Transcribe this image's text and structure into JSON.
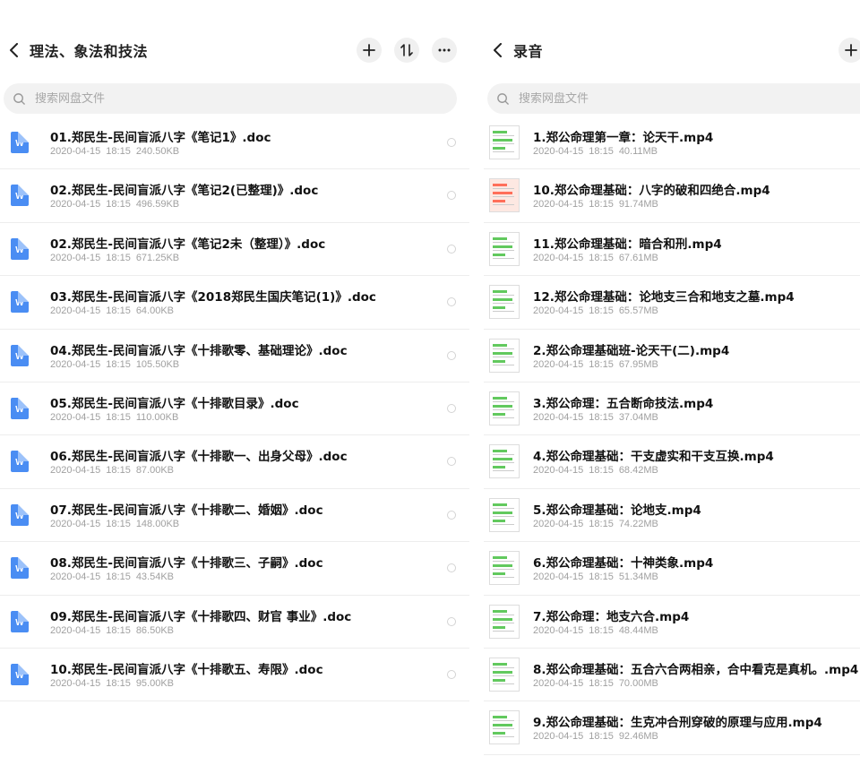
{
  "left": {
    "title": "理法、象法和技法",
    "search_placeholder": "搜索网盘文件",
    "icon_letter": "W",
    "files": [
      {
        "name": "01.郑民生-民间盲派八字《笔记1》.doc",
        "date": "2020-04-15",
        "time": "18:15",
        "size": "240.50KB"
      },
      {
        "name": "02.郑民生-民间盲派八字《笔记2(已整理)》.doc",
        "date": "2020-04-15",
        "time": "18:15",
        "size": "496.59KB"
      },
      {
        "name": "02.郑民生-民间盲派八字《笔记2未（整理）》.doc",
        "date": "2020-04-15",
        "time": "18:15",
        "size": "671.25KB"
      },
      {
        "name": "03.郑民生-民间盲派八字《2018郑民生国庆笔记(1)》.doc",
        "date": "2020-04-15",
        "time": "18:15",
        "size": "64.00KB"
      },
      {
        "name": "04.郑民生-民间盲派八字《十排歌零、基础理论》.doc",
        "date": "2020-04-15",
        "time": "18:15",
        "size": "105.50KB"
      },
      {
        "name": "05.郑民生-民间盲派八字《十排歌目录》.doc",
        "date": "2020-04-15",
        "time": "18:15",
        "size": "110.00KB"
      },
      {
        "name": "06.郑民生-民间盲派八字《十排歌一、出身父母》.doc",
        "date": "2020-04-15",
        "time": "18:15",
        "size": "87.00KB"
      },
      {
        "name": "07.郑民生-民间盲派八字《十排歌二、婚姻》.doc",
        "date": "2020-04-15",
        "time": "18:15",
        "size": "148.00KB"
      },
      {
        "name": "08.郑民生-民间盲派八字《十排歌三、子嗣》.doc",
        "date": "2020-04-15",
        "time": "18:15",
        "size": "43.54KB"
      },
      {
        "name": "09.郑民生-民间盲派八字《十排歌四、财官 事业》.doc",
        "date": "2020-04-15",
        "time": "18:15",
        "size": "86.50KB"
      },
      {
        "name": "10.郑民生-民间盲派八字《十排歌五、寿限》.doc",
        "date": "2020-04-15",
        "time": "18:15",
        "size": "95.00KB"
      }
    ]
  },
  "right": {
    "title": "录音",
    "search_placeholder": "搜索网盘文件",
    "files": [
      {
        "name": "1.郑公命理第一章：论天干.mp4",
        "date": "2020-04-15",
        "time": "18:15",
        "size": "40.11MB"
      },
      {
        "name": "10.郑公命理基础：八字的破和四绝合.mp4",
        "date": "2020-04-15",
        "time": "18:15",
        "size": "91.74MB"
      },
      {
        "name": "11.郑公命理基础：暗合和刑.mp4",
        "date": "2020-04-15",
        "time": "18:15",
        "size": "67.61MB"
      },
      {
        "name": "12.郑公命理基础：论地支三合和地支之墓.mp4",
        "date": "2020-04-15",
        "time": "18:15",
        "size": "65.57MB"
      },
      {
        "name": "2.郑公命理基础班-论天干(二).mp4",
        "date": "2020-04-15",
        "time": "18:15",
        "size": "67.95MB"
      },
      {
        "name": "3.郑公命理：五合断命技法.mp4",
        "date": "2020-04-15",
        "time": "18:15",
        "size": "37.04MB"
      },
      {
        "name": "4.郑公命理基础：干支虚实和干支互换.mp4",
        "date": "2020-04-15",
        "time": "18:15",
        "size": "68.42MB"
      },
      {
        "name": "5.郑公命理基础：论地支.mp4",
        "date": "2020-04-15",
        "time": "18:15",
        "size": "74.22MB"
      },
      {
        "name": "6.郑公命理基础：十神类象.mp4",
        "date": "2020-04-15",
        "time": "18:15",
        "size": "51.34MB"
      },
      {
        "name": "7.郑公命理：地支六合.mp4",
        "date": "2020-04-15",
        "time": "18:15",
        "size": "48.44MB"
      },
      {
        "name": "8.郑公命理基础：五合六合两相亲，合中看克是真机。.mp4",
        "date": "2020-04-15",
        "time": "18:15",
        "size": "70.00MB"
      },
      {
        "name": "9.郑公命理基础：生克冲合刑穿破的原理与应用.mp4",
        "date": "2020-04-15",
        "time": "18:15",
        "size": "92.46MB"
      }
    ]
  }
}
